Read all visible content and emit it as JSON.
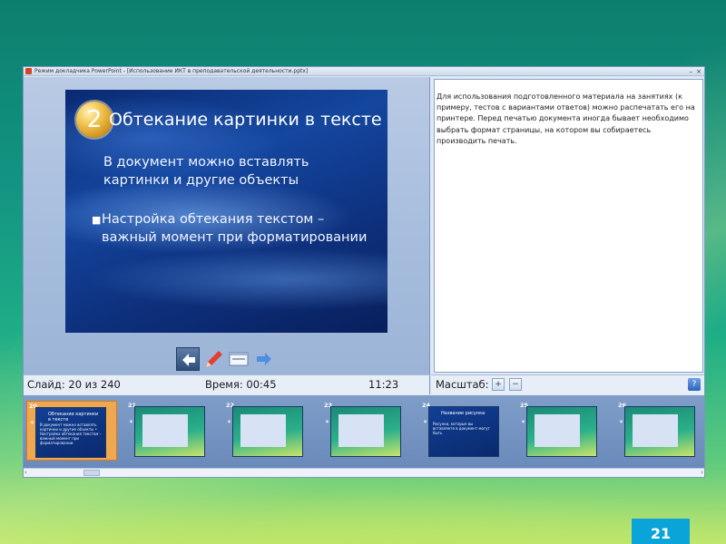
{
  "window": {
    "title": "Режим докладчика PowerPoint - [Использование ИКТ в преподавательской деятельности.pptx]",
    "minimize_glyph": "–",
    "close_glyph": "×"
  },
  "slide": {
    "badge_number": "2",
    "title": "Обтекание картинки в тексте",
    "subtitle": "В документ можно вставлять картинки и другие объекты",
    "bullet": "Настройка обтекания текстом – важный момент при форматировании"
  },
  "toolbar": {
    "icons": [
      "arrow-left-icon",
      "pen-icon",
      "screen-icon",
      "arrow-right-icon"
    ]
  },
  "status": {
    "slide_label": "Слайд: 20 из 240",
    "time_label": "Время: 00:45",
    "clock": "11:23"
  },
  "notes": {
    "text": "Для использования подготовленного материала на занятиях (к примеру, тестов с вариантами ответов) можно распечатать его на принтере. Перед печатью документа иногда бывает необходимо выбрать формат страницы, на котором вы собираетесь производить печать."
  },
  "zoom": {
    "label": "Масштаб:",
    "zoom_in_glyph": "+",
    "zoom_out_glyph": "−",
    "help_glyph": "?"
  },
  "thumbnails": [
    {
      "num": "20",
      "title": "Обтекание картинки в тексте",
      "text": "В документ можно вставлять картинки и другие объекты • Настройка обтекания текстом – важный момент при форматировании"
    },
    {
      "num": "21"
    },
    {
      "num": "22"
    },
    {
      "num": "23"
    },
    {
      "num": "24",
      "title": "Название рисунка",
      "text": "Рисунки, которые вы вставляете в документ могут быть"
    },
    {
      "num": "25"
    },
    {
      "num": "26"
    }
  ],
  "scrollbar": {
    "left_glyph": "‹",
    "right_glyph": "›"
  },
  "page_number": "21",
  "colors": {
    "accent_blue": "#0aa4d8",
    "active_thumb": "#f0a850",
    "slide_bg": "#14479f"
  }
}
